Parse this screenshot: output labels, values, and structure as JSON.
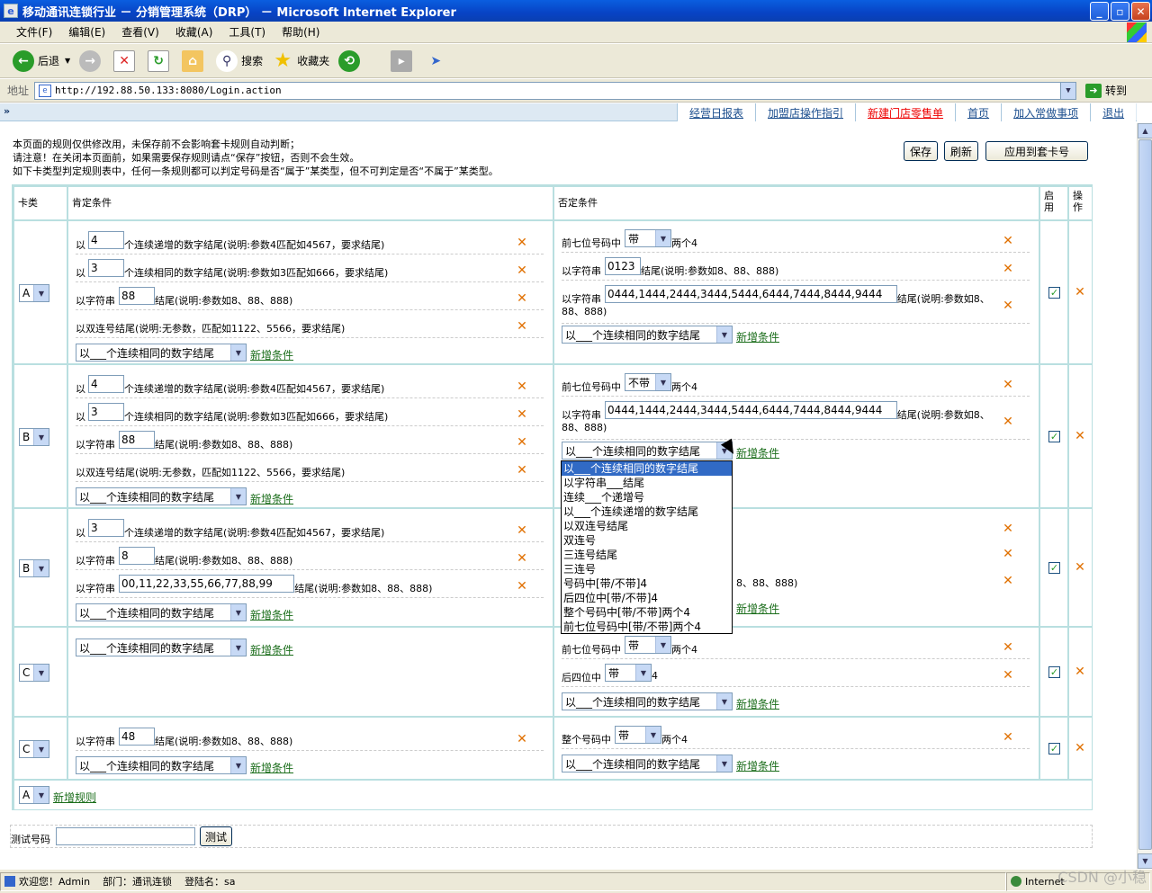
{
  "window": {
    "title": "移动通讯连锁行业 － 分销管理系统（DRP） － Microsoft Internet Explorer"
  },
  "menu": [
    "文件(F)",
    "编辑(E)",
    "查看(V)",
    "收藏(A)",
    "工具(T)",
    "帮助(H)"
  ],
  "toolbar": {
    "back": "后退",
    "search": "搜索",
    "favorites": "收藏夹"
  },
  "address": {
    "label": "地址",
    "url": "http://192.88.50.133:8080/Login.action",
    "go": "转到"
  },
  "nav": [
    "经营日报表",
    "加盟店操作指引",
    "新建门店零售单",
    "首页",
    "加入常做事项",
    "退出"
  ],
  "notice": [
    "本页面的规则仅供修改用，未保存前不会影响套卡规则自动判断；",
    "请注意！在关闭本页面前，如果需要保存规则请点“保存”按钮，否则不会生效。",
    "如下卡类型判定规则表中，任何一条规则都可以判定号码是否“属于”某类型，但不可判定是否“不属于”某类型。"
  ],
  "buttons": {
    "save": "保存",
    "refresh": "刷新",
    "apply": "应用到套卡号"
  },
  "headers": {
    "type": "卡类",
    "positive": "肯定条件",
    "negative": "否定条件",
    "enable": "启用",
    "op": "操作"
  },
  "cond_select": "以___个连续相同的数字结尾",
  "add_condition": "新增条件",
  "add_rule": "新增规则",
  "new_rule_type": "A",
  "rules": [
    {
      "type": "A",
      "pos": [
        {
          "pre": "以",
          "input": "4",
          "post": "个连续递增的数字结尾(说明:参数4匹配如4567，要求结尾)"
        },
        {
          "pre": "以",
          "input": "3",
          "post": "个连续相同的数字结尾(说明:参数如3匹配如666，要求结尾)"
        },
        {
          "pre": "以字符串",
          "input": "88",
          "post": "结尾(说明:参数如8、88、888)"
        },
        {
          "pre": "以双连号结尾(说明:无参数，匹配如1122、5566，要求结尾)"
        }
      ],
      "neg": [
        {
          "pre": "前七位号码中",
          "select": "带",
          "post": "两个4"
        },
        {
          "pre": "以字符串",
          "input": "0123",
          "post": "结尾(说明:参数如8、88、888)"
        },
        {
          "pre": "以字符串",
          "input": "0444,1444,2444,3444,5444,6444,7444,8444,9444",
          "post": "结尾(说明:参数如8、",
          "post2": "88、888)"
        }
      ]
    },
    {
      "type": "B",
      "pos": [
        {
          "pre": "以",
          "input": "4",
          "post": "个连续递增的数字结尾(说明:参数4匹配如4567，要求结尾)"
        },
        {
          "pre": "以",
          "input": "3",
          "post": "个连续相同的数字结尾(说明:参数如3匹配如666，要求结尾)"
        },
        {
          "pre": "以字符串",
          "input": "88",
          "post": "结尾(说明:参数如8、88、888)"
        },
        {
          "pre": "以双连号结尾(说明:无参数，匹配如1122、5566，要求结尾)"
        }
      ],
      "neg": [
        {
          "pre": "前七位号码中",
          "select": "不带",
          "post": "两个4"
        },
        {
          "pre": "以字符串",
          "input": "0444,1444,2444,3444,5444,6444,7444,8444,9444",
          "post": "结尾(说明:参数如8、",
          "post2": "88、888)"
        }
      ]
    },
    {
      "type": "B",
      "pos": [
        {
          "pre": "以",
          "input": "3",
          "post": "个连续递增的数字结尾(说明:参数4匹配如4567，要求结尾)"
        },
        {
          "pre": "以字符串",
          "input": "8",
          "post": "结尾(说明:参数如8、88、888)"
        },
        {
          "pre": "以字符串",
          "input": "00,11,22,33,55,66,77,88,99",
          "post": "结尾(说明:参数如8、88、888)"
        }
      ],
      "neg_partial": "8、88、888)"
    },
    {
      "type": "C",
      "pos": [],
      "neg": [
        {
          "pre": "前七位号码中",
          "select": "带",
          "post": "两个4"
        },
        {
          "pre": "后四位中",
          "select": "带",
          "post": "4"
        }
      ]
    },
    {
      "type": "C",
      "pos": [
        {
          "pre": "以字符串",
          "input": "48",
          "post": "结尾(说明:参数如8、88、888)"
        }
      ],
      "neg": [
        {
          "pre": "整个号码中",
          "select": "带",
          "post": "两个4"
        }
      ]
    }
  ],
  "dropdown_options": [
    "以___个连续相同的数字结尾",
    "以字符串___结尾",
    "连续___个递增号",
    "以___个连续递增的数字结尾",
    "以双连号结尾",
    "双连号",
    "三连号结尾",
    "三连号",
    "号码中[带/不带]4",
    "后四位中[带/不带]4",
    "整个号码中[带/不带]两个4",
    "前七位号码中[带/不带]两个4"
  ],
  "test": {
    "label": "测试号码",
    "button": "测试"
  },
  "status": {
    "welcome": "欢迎您！Admin",
    "dept": "部门：通讯连锁",
    "login": "登陆名：sa",
    "zone": "Internet"
  },
  "watermark": "CSDN @小稳"
}
